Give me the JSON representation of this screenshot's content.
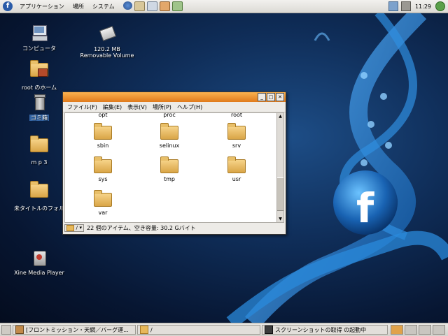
{
  "top_panel": {
    "menus": [
      "アプリケーション",
      "場所",
      "システム"
    ],
    "clock": "11:29"
  },
  "desktop": {
    "icons": [
      {
        "label": "コンピュータ",
        "icon": "computer-icon"
      },
      {
        "label": "120.2 MB\nRemovable Volume",
        "icon": "removable-drive-icon"
      },
      {
        "label": "root のホーム",
        "icon": "home-folder-icon"
      },
      {
        "label": "ゴミ箱",
        "icon": "trash-icon"
      },
      {
        "label": "m p 3",
        "icon": "folder-icon"
      },
      {
        "label": "未タイトルのフォル",
        "icon": "folder-icon"
      },
      {
        "label": "Xine Media Player",
        "icon": "media-player-icon"
      }
    ]
  },
  "window": {
    "menu": [
      "ファイル(F)",
      "編集(E)",
      "表示(V)",
      "場所(P)",
      "ヘルプ(H)"
    ],
    "buttons": {
      "minimize": "_",
      "maximize": "□",
      "close": "✕"
    },
    "items": [
      "opt",
      "proc",
      "root",
      "sbin",
      "selinux",
      "srv",
      "sys",
      "tmp",
      "usr",
      "var"
    ],
    "location": "/",
    "status": "22 個のアイテム、空き容量: 30.2 Gバイト"
  },
  "bottom_panel": {
    "tasks": [
      "[フロントミッション・天網／バーグ運...",
      "/",
      "スクリーンショットの取得 の起動中"
    ]
  },
  "colors": {
    "accent": "#3465a4",
    "title_bar": "#f08c2a",
    "folder": "#e7b85a"
  }
}
